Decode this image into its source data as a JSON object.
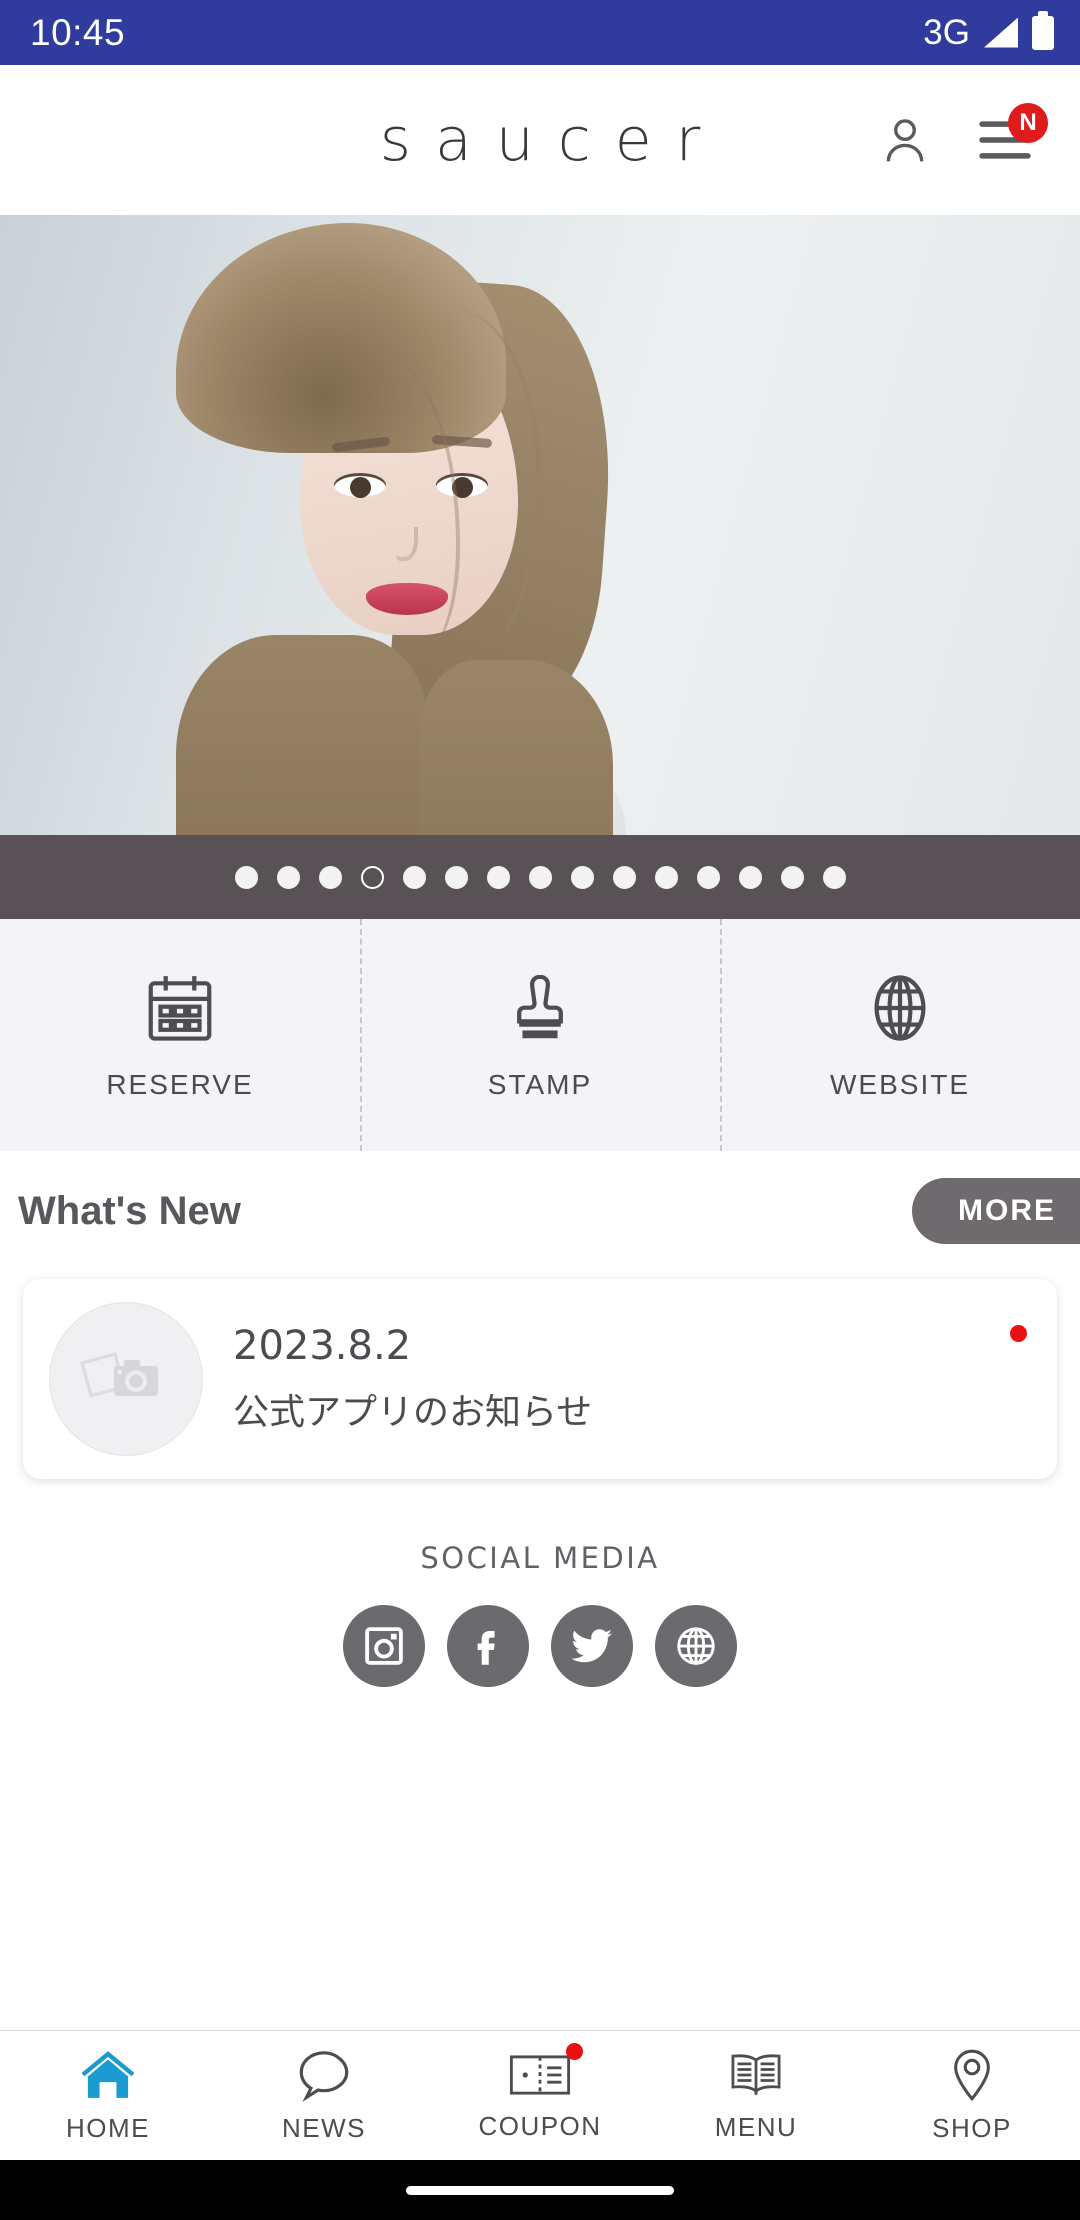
{
  "status_bar": {
    "time": "10:45",
    "network": "3G",
    "signal_icon": "signal-triangle-icon",
    "battery_icon": "battery-full-icon",
    "background_color": "#2F3C9E"
  },
  "header": {
    "brand": "saucer",
    "account_icon": "person-icon",
    "menu_icon": "hamburger-menu-icon",
    "menu_badge": "N",
    "badge_color": "#E01B1B"
  },
  "hero": {
    "alt": "hair-salon-model-photo"
  },
  "carousel": {
    "total_dots": 15,
    "active_index": 3
  },
  "quick_actions": [
    {
      "label": "RESERVE",
      "icon": "calendar-icon"
    },
    {
      "label": "STAMP",
      "icon": "stamp-icon"
    },
    {
      "label": "WEBSITE",
      "icon": "globe-icon"
    }
  ],
  "whats_new": {
    "title": "What's New",
    "more_label": "MORE",
    "items": [
      {
        "date": "2023.8.2",
        "title": "公式アプリのお知らせ",
        "thumbnail_icon": "photo-camera-placeholder-icon",
        "unread": true
      }
    ]
  },
  "social_media": {
    "title": "SOCIAL MEDIA",
    "items": [
      {
        "name": "instagram",
        "icon": "instagram-icon"
      },
      {
        "name": "facebook",
        "icon": "facebook-icon"
      },
      {
        "name": "twitter",
        "icon": "twitter-icon"
      },
      {
        "name": "website",
        "icon": "globe-icon"
      }
    ]
  },
  "bottom_nav": {
    "active_color": "#1B9BD1",
    "items": [
      {
        "label": "HOME",
        "icon": "home-icon",
        "active": true,
        "badge": false
      },
      {
        "label": "NEWS",
        "icon": "speech-bubble-icon",
        "active": false,
        "badge": false
      },
      {
        "label": "COUPON",
        "icon": "ticket-icon",
        "active": false,
        "badge": true
      },
      {
        "label": "MENU",
        "icon": "open-book-icon",
        "active": false,
        "badge": false
      },
      {
        "label": "SHOP",
        "icon": "map-pin-icon",
        "active": false,
        "badge": false
      }
    ]
  }
}
